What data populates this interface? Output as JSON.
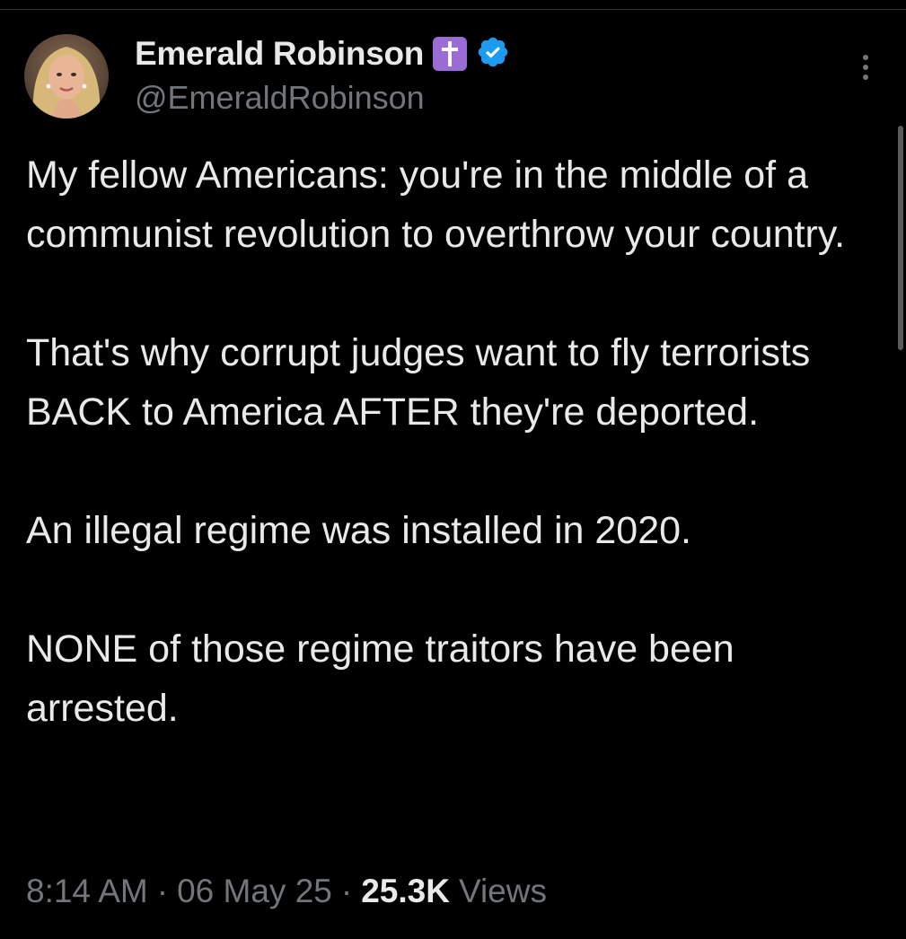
{
  "author": {
    "display_name": "Emerald Robinson",
    "handle": "@EmeraldRobinson",
    "name_emoji": "latin-cross-emoji",
    "verified_icon": "verified-badge-icon",
    "verified_color": "#1d9bf0",
    "emoji_color": "#9b6bd6"
  },
  "tweet": {
    "paragraphs": [
      "My fellow Americans: you're in the middle of a communist revolution to overthrow your country.",
      "That's why corrupt judges want to fly terrorists BACK to America AFTER they're deported.",
      "An illegal regime was installed in 2020.",
      "NONE of those regime traitors have been arrested."
    ]
  },
  "meta": {
    "time": "8:14 AM",
    "separator": "·",
    "date": "06 May 25",
    "views_count": "25.3K",
    "views_label": "Views"
  },
  "icons": {
    "more": "more-options-icon",
    "avatar": "avatar"
  },
  "colors": {
    "background": "#000000",
    "text_primary": "#e7e9ea",
    "text_secondary": "#71767b"
  }
}
